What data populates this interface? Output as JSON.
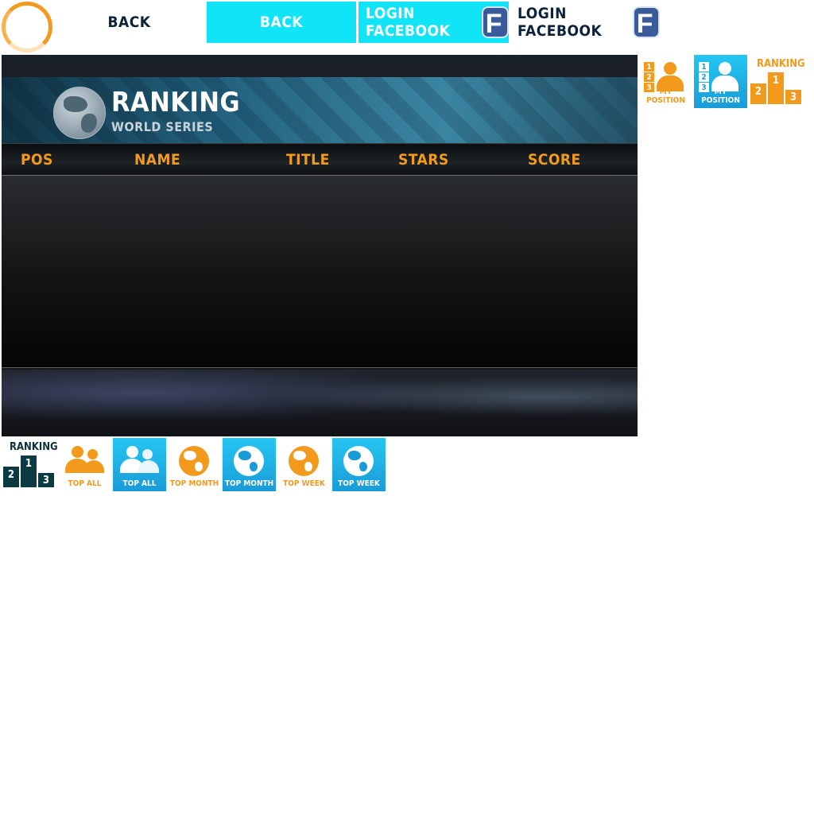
{
  "topbar": {
    "back_plain": "BACK",
    "back_cyan": "BACK",
    "login_fb_cyan": "LOGIN FACEBOOK",
    "login_fb_plain": "LOGIN FACEBOOK",
    "fb_glyph": "f"
  },
  "panel": {
    "title": "RANKING",
    "subtitle": "WORLD SERIES",
    "columns": {
      "pos": "POS",
      "name": "NAME",
      "title": "TITLE",
      "stars": "STARS",
      "score": "SCORE"
    }
  },
  "side_icons": {
    "my_position_orange": "MY POSITION",
    "my_position_blue": "MY POSITION",
    "ranking_orange": "RANKING",
    "numbers": [
      "1",
      "2",
      "3"
    ],
    "podium": {
      "first": "1",
      "second": "2",
      "third": "3"
    }
  },
  "bottom_icons": {
    "ranking_dark": "RANKING",
    "podium": {
      "first": "1",
      "second": "2",
      "third": "3"
    },
    "top_all_orange": "TOP ALL",
    "top_all_blue": "TOP ALL",
    "top_month_orange": "TOP MONTH",
    "top_month_blue": "TOP MONTH",
    "top_week_orange": "TOP WEEK",
    "top_week_blue": "TOP WEEK"
  },
  "colors": {
    "accent_orange": "#f39a1c",
    "cyan": "#12e4f7",
    "blue_tile": "#1a9bd8",
    "dark_navy": "#0b2239"
  }
}
